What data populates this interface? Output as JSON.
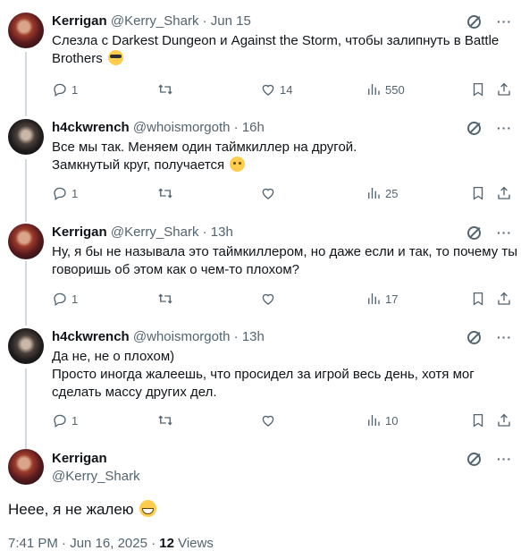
{
  "tweets": [
    {
      "name": "Kerrigan",
      "handle": "@Kerry_Shark",
      "time": "· Jun 15",
      "lines": [
        "Слезла с Darkest Dungeon и Against the Storm, чтобы залипнуть в Battle",
        "Brothers"
      ],
      "replies": "1",
      "retweets": "",
      "likes": "14",
      "views": "550"
    },
    {
      "name": "h4ckwrench",
      "handle": "@whoismorgoth",
      "time": "· 16h",
      "lines": [
        "Все мы так. Меняем один таймкиллер на другой.",
        "Замкнутый круг, получается"
      ],
      "replies": "1",
      "retweets": "",
      "likes": "",
      "views": "25"
    },
    {
      "name": "Kerrigan",
      "handle": "@Kerry_Shark",
      "time": "· 13h",
      "lines": [
        "Ну, я бы не называла это таймкиллером, но даже если и так, то почему ты",
        "говоришь об этом как о чем-то плохом?"
      ],
      "replies": "1",
      "retweets": "",
      "likes": "",
      "views": "17"
    },
    {
      "name": "h4ckwrench",
      "handle": "@whoismorgoth",
      "time": "· 13h",
      "lines": [
        "Да не, не о плохом)",
        "Просто иногда жалеешь, что просидел за игрой весь день, хотя мог",
        "сделать массу других дел."
      ],
      "replies": "1",
      "retweets": "",
      "likes": "",
      "views": "10"
    }
  ],
  "main": {
    "name": "Kerrigan",
    "handle": "@Kerry_Shark",
    "text": "Неее, я не жалею",
    "time": "7:41 PM · Jun 16, 2025 · ",
    "views_count": "12",
    "views_label": " Views"
  },
  "icons": {
    "reply": "reply-icon",
    "retweet": "retweet-icon",
    "like": "heart-icon",
    "views": "views-icon",
    "bookmark": "bookmark-icon",
    "share": "share-icon",
    "grok": "grok-icon",
    "more": "more-icon",
    "emoji1": "sunglasses-emoji",
    "emoji2": "thinking-emoji",
    "emoji3": "grinning-emoji"
  },
  "colors": {
    "text": "#0f1419",
    "secondary": "#536471",
    "thread_line": "#cfd9de"
  }
}
